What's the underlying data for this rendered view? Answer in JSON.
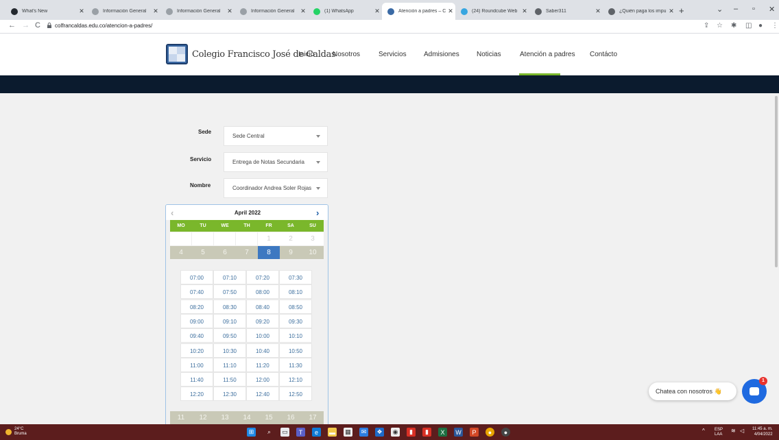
{
  "browser": {
    "tabs": [
      {
        "title": "What's New",
        "icon": "github-icon",
        "color": "#24292f"
      },
      {
        "title": "Información General",
        "icon": "doc-icon",
        "color": "#9aa0a6"
      },
      {
        "title": "Información General",
        "icon": "doc-icon",
        "color": "#9aa0a6"
      },
      {
        "title": "Información General",
        "icon": "doc-icon",
        "color": "#9aa0a6"
      },
      {
        "title": "(1) WhatsApp",
        "icon": "whatsapp-icon",
        "color": "#25d366"
      },
      {
        "title": "Atención a padres – C",
        "icon": "school-icon",
        "color": "#3b6aa5",
        "active": true
      },
      {
        "title": "(24) Roundcube Web",
        "icon": "roundcube-icon",
        "color": "#37a6e0"
      },
      {
        "title": "Saber311",
        "icon": "globe-icon",
        "color": "#5f6368"
      },
      {
        "title": "¿Quién paga los impu",
        "icon": "pinterest-icon",
        "color": "#5f6368"
      }
    ],
    "url": "colfrancaldas.edu.co/atencion-a-padres/"
  },
  "site": {
    "logo_text": "Colegio Francisco José de Caldas",
    "nav": [
      "Inicio",
      "Nosotros",
      "Servicios",
      "Admisiones",
      "Noticias",
      "Atención a padres",
      "Contácto"
    ]
  },
  "form": {
    "sede": {
      "label": "Sede",
      "value": "Sede Central"
    },
    "servicio": {
      "label": "Servicio",
      "value": "Entrega de Notas Secundaria"
    },
    "nombre": {
      "label": "Nombre",
      "value": "Coordinador Andrea Soler Rojas"
    }
  },
  "calendar": {
    "month": "April 2022",
    "weekdays": [
      "MO",
      "TU",
      "WE",
      "TH",
      "FR",
      "SA",
      "SU"
    ],
    "week1": [
      {
        "d": "",
        "s": "empty"
      },
      {
        "d": "",
        "s": "empty"
      },
      {
        "d": "",
        "s": "empty"
      },
      {
        "d": "",
        "s": "empty"
      },
      {
        "d": "1",
        "s": "future"
      },
      {
        "d": "2",
        "s": "future"
      },
      {
        "d": "3",
        "s": "future"
      }
    ],
    "week2": [
      {
        "d": "4",
        "s": "past"
      },
      {
        "d": "5",
        "s": "past"
      },
      {
        "d": "6",
        "s": "past"
      },
      {
        "d": "7",
        "s": "past"
      },
      {
        "d": "8",
        "s": "sel"
      },
      {
        "d": "9",
        "s": "past"
      },
      {
        "d": "10",
        "s": "past"
      }
    ],
    "slots": [
      "07:00",
      "07:10",
      "07:20",
      "07:30",
      "07:40",
      "07:50",
      "08:00",
      "08:10",
      "08:20",
      "08:30",
      "08:40",
      "08:50",
      "09:00",
      "09:10",
      "09:20",
      "09:30",
      "09:40",
      "09:50",
      "10:00",
      "10:10",
      "10:20",
      "10:30",
      "10:40",
      "10:50",
      "11:00",
      "11:10",
      "11:20",
      "11:30",
      "11:40",
      "11:50",
      "12:00",
      "12:10",
      "12:20",
      "12:30",
      "12:40",
      "12:50"
    ],
    "week3": [
      "11",
      "12",
      "13",
      "14",
      "15",
      "16",
      "17"
    ],
    "selected_color": "#3d78c1",
    "accent_color": "#7ab72b"
  },
  "chat": {
    "label": "Chatea con nosotros",
    "emoji": "👋",
    "badge": "1"
  },
  "taskbar": {
    "weather_temp": "24°C",
    "weather_desc": "Bruma",
    "lang": "ESP",
    "lang2": "LAA",
    "time": "11:45 a. m.",
    "date": "4/04/2022"
  }
}
